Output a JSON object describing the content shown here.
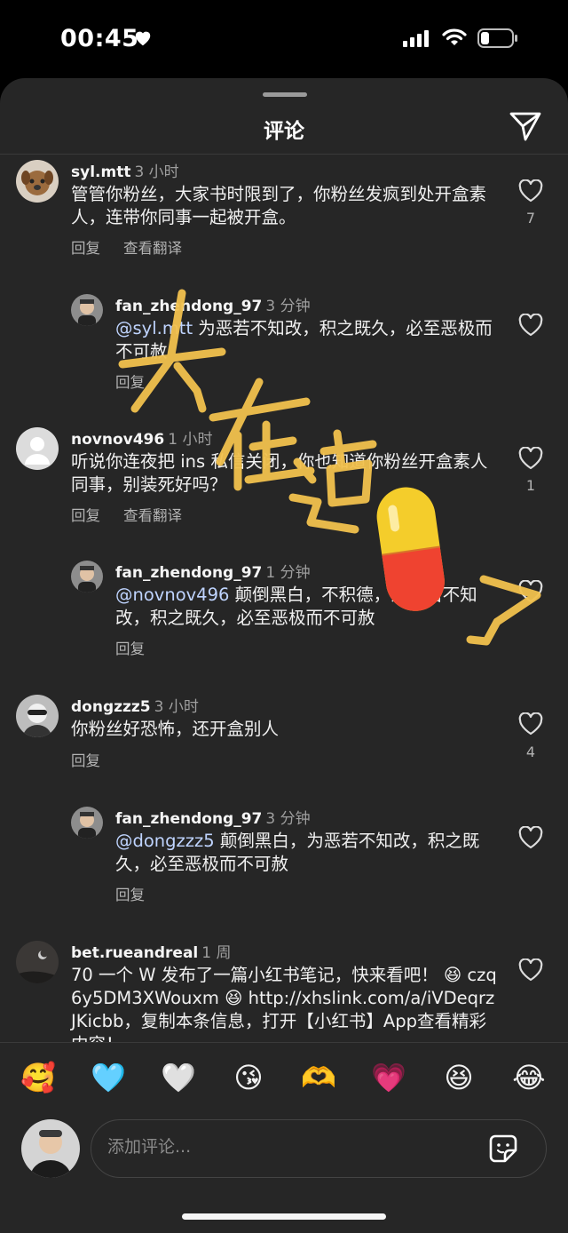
{
  "status_bar": {
    "time": "00:45"
  },
  "header": {
    "title": "评论"
  },
  "comments": [
    {
      "username": "syl.mtt",
      "time": "3 小时",
      "text": "管管你粉丝，大家书时限到了，你粉丝发疯到处开盒素人，连带你同事一起被开盒。",
      "actions": [
        "回复",
        "查看翻译"
      ],
      "likes": "7"
    },
    {
      "username": "fan_zhendong_97",
      "time": "3 分钟",
      "mention": "@syl.mtt",
      "text": " 为恶若不知改，积之既久，必至恶极而不可赦",
      "actions": [
        "回复"
      ]
    },
    {
      "username": "novnov496",
      "time": "1 小时",
      "text": "听说你连夜把 ins 私信关闭，你也知道你粉丝开盒素人同事，别装死好吗？",
      "actions": [
        "回复",
        "查看翻译"
      ],
      "likes": "1"
    },
    {
      "username": "fan_zhendong_97",
      "time": "1 分钟",
      "mention": "@novnov496",
      "text": " 颠倒黑白，不积德，为恶若不知改，积之既久，必至恶极而不可赦",
      "actions": [
        "回复"
      ]
    },
    {
      "username": "dongzzz5",
      "time": "3 小时",
      "text": "你粉丝好恐怖，还开盒别人",
      "actions": [
        "回复"
      ],
      "likes": "4"
    },
    {
      "username": "fan_zhendong_97",
      "time": "3 分钟",
      "mention": "@dongzzz5",
      "text": " 颠倒黑白，为恶若不知改，积之既久，必至恶极而不可赦",
      "actions": [
        "回复"
      ]
    },
    {
      "username": "bet.rueandreal",
      "time": "1 周",
      "text": "70 一个 W 发布了一篇小红书笔记，快来看吧！ 😆 czq6y5DM3XWouxm 😆 http://xhslink.com/a/iVDeqrzJKicbb，复制本条信息，打开【小红书】App查看精彩内容！"
    }
  ],
  "emoji_bar": [
    "🥰",
    "🩵",
    "🤍",
    "😘",
    "🫶",
    "💗",
    "😆",
    "😂"
  ],
  "input": {
    "placeholder": "添加评论..."
  },
  "overlay": {
    "handwriting": "大在造了"
  }
}
